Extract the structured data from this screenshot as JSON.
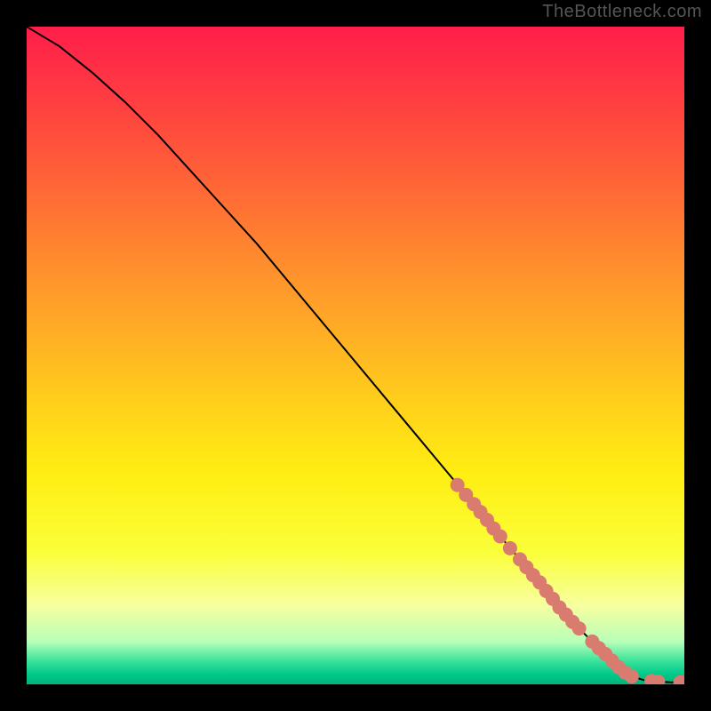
{
  "watermark": "TheBottleneck.com",
  "colors": {
    "background": "#000000",
    "gradient_stops": [
      {
        "offset": 0.0,
        "color": "#ff1e4a"
      },
      {
        "offset": 0.1,
        "color": "#ff3a42"
      },
      {
        "offset": 0.22,
        "color": "#ff5f38"
      },
      {
        "offset": 0.35,
        "color": "#ff8a2e"
      },
      {
        "offset": 0.48,
        "color": "#ffb224"
      },
      {
        "offset": 0.58,
        "color": "#ffd21a"
      },
      {
        "offset": 0.68,
        "color": "#ffee12"
      },
      {
        "offset": 0.8,
        "color": "#faff3a"
      },
      {
        "offset": 0.88,
        "color": "#f7ffa0"
      },
      {
        "offset": 0.935,
        "color": "#b8ffb8"
      },
      {
        "offset": 0.965,
        "color": "#38e29a"
      },
      {
        "offset": 0.985,
        "color": "#00c98a"
      },
      {
        "offset": 1.0,
        "color": "#00b37a"
      }
    ],
    "curve": "#000000",
    "marker_fill": "#d97b6f",
    "marker_stroke": "#d97b6f"
  },
  "chart_data": {
    "type": "line",
    "title": "",
    "xlabel": "",
    "ylabel": "",
    "xlim": [
      0,
      100
    ],
    "ylim": [
      0,
      100
    ],
    "series": [
      {
        "name": "bottleneck-curve",
        "x": [
          0,
          5,
          10,
          15,
          20,
          25,
          30,
          35,
          40,
          45,
          50,
          55,
          60,
          65,
          70,
          72,
          75,
          78,
          80,
          82,
          84,
          86,
          88,
          90,
          92,
          94,
          96,
          98,
          100
        ],
        "y": [
          100,
          97,
          93,
          88.5,
          83.5,
          78,
          72.5,
          67,
          61,
          55,
          49,
          43,
          37,
          31,
          25,
          22.5,
          19,
          15.5,
          13,
          10.5,
          8.5,
          6.5,
          4.5,
          2.5,
          1.2,
          0.6,
          0.4,
          0.3,
          0.3
        ]
      }
    ],
    "markers": [
      {
        "x": 65.5,
        "y": 30.3
      },
      {
        "x": 66.8,
        "y": 28.8
      },
      {
        "x": 68.0,
        "y": 27.4
      },
      {
        "x": 69.0,
        "y": 26.2
      },
      {
        "x": 70.0,
        "y": 25.0
      },
      {
        "x": 71.0,
        "y": 23.7
      },
      {
        "x": 72.0,
        "y": 22.5
      },
      {
        "x": 73.5,
        "y": 20.7
      },
      {
        "x": 75.0,
        "y": 19.0
      },
      {
        "x": 76.0,
        "y": 17.8
      },
      {
        "x": 77.0,
        "y": 16.6
      },
      {
        "x": 78.0,
        "y": 15.5
      },
      {
        "x": 79.0,
        "y": 14.2
      },
      {
        "x": 80.0,
        "y": 13.0
      },
      {
        "x": 81.0,
        "y": 11.7
      },
      {
        "x": 82.0,
        "y": 10.6
      },
      {
        "x": 83.0,
        "y": 9.5
      },
      {
        "x": 84.0,
        "y": 8.5
      },
      {
        "x": 86.0,
        "y": 6.5
      },
      {
        "x": 87.0,
        "y": 5.5
      },
      {
        "x": 88.0,
        "y": 4.6
      },
      {
        "x": 89.0,
        "y": 3.6
      },
      {
        "x": 90.0,
        "y": 2.6
      },
      {
        "x": 91.0,
        "y": 1.8
      },
      {
        "x": 92.0,
        "y": 1.2
      },
      {
        "x": 95.0,
        "y": 0.5
      },
      {
        "x": 96.0,
        "y": 0.4
      },
      {
        "x": 99.4,
        "y": 0.3
      },
      {
        "x": 100.0,
        "y": 0.3
      }
    ]
  }
}
